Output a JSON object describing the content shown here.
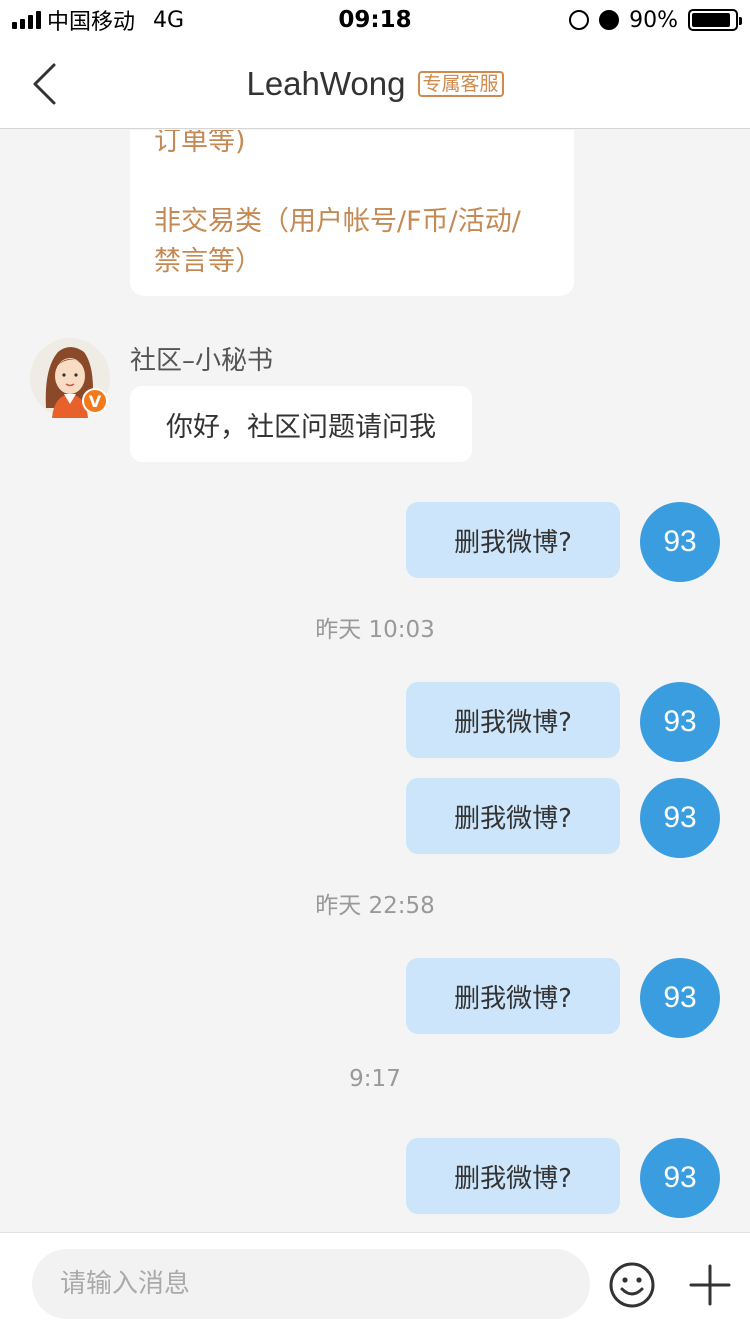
{
  "status": {
    "carrier": "中国移动",
    "network": "4G",
    "time": "09:18",
    "battery_percent": "90%",
    "battery_level": 0.9
  },
  "nav": {
    "title": "LeahWong",
    "badge": "专属客服"
  },
  "menu_card": {
    "lines": [
      "订单等)",
      "",
      "非交易类（用户帐号/F币/活动/",
      "禁言等）"
    ]
  },
  "incoming": {
    "sender": "社区–小秘书",
    "badge": "V",
    "text": "你好，社区问题请问我"
  },
  "outgoing": {
    "avatar_text": "93",
    "messages": [
      "删我微博?",
      "删我微博?",
      "删我微博?",
      "删我微博?",
      "删我微博?"
    ]
  },
  "timestamps": [
    "昨天 10:03",
    "昨天 22:58",
    "9:17"
  ],
  "input": {
    "placeholder": "请输入消息"
  },
  "colors": {
    "accent": "#3a9de0",
    "outgoing_bubble": "#cde5fa",
    "badge": "#d08a4d"
  }
}
